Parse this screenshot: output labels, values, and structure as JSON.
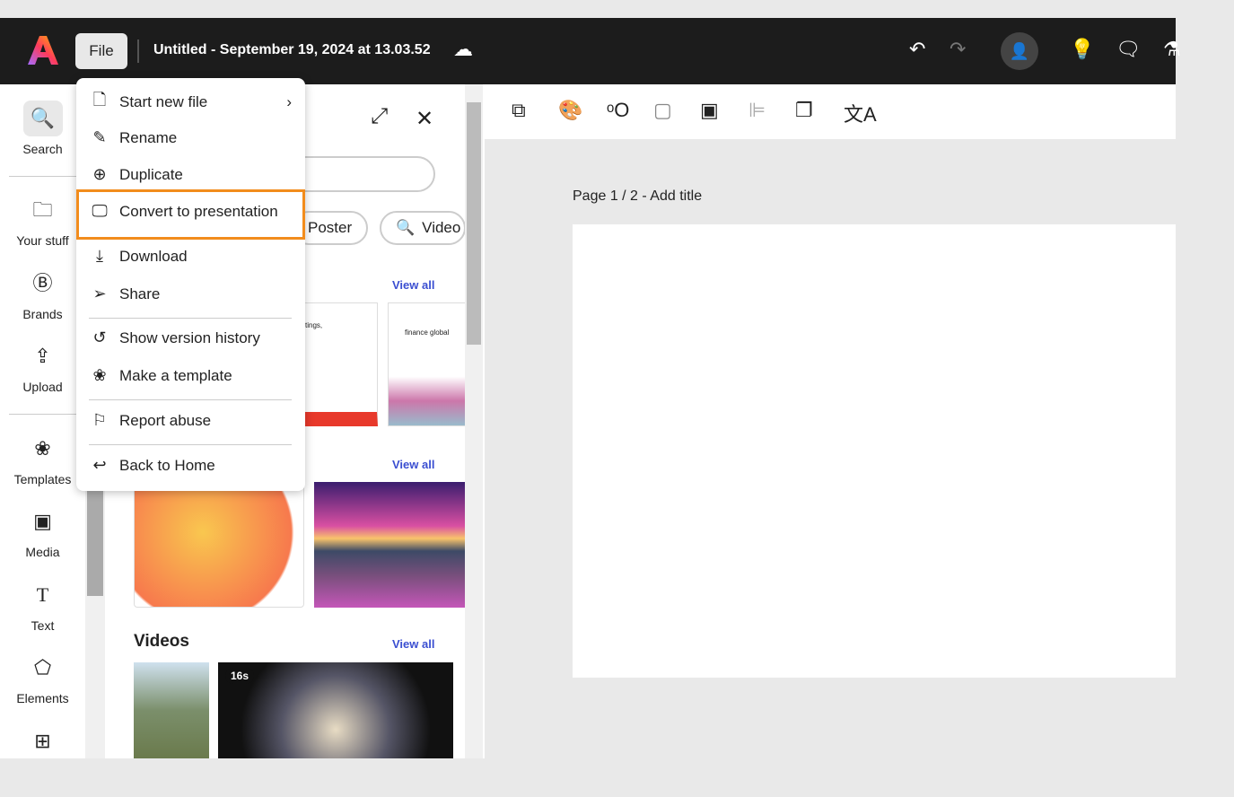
{
  "header": {
    "file_label": "File",
    "doc_title": "Untitled - September 19, 2024 at 13.03.52"
  },
  "sidebar": {
    "items": [
      {
        "label": "Search",
        "icon": "search-icon"
      },
      {
        "label": "Your stuff",
        "icon": "folder-icon"
      },
      {
        "label": "Brands",
        "icon": "brand-icon"
      },
      {
        "label": "Upload",
        "icon": "upload-icon"
      },
      {
        "label": "Templates",
        "icon": "templates-icon"
      },
      {
        "label": "Media",
        "icon": "media-icon"
      },
      {
        "label": "Text",
        "icon": "text-icon"
      },
      {
        "label": "Elements",
        "icon": "elements-icon"
      }
    ]
  },
  "menu": {
    "items": [
      "Start new file",
      "Rename",
      "Duplicate",
      "Convert to presentation",
      "Download",
      "Share",
      "Show version history",
      "Make a template",
      "Report abuse",
      "Back to Home"
    ]
  },
  "panel": {
    "chips": [
      "Poster",
      "Video"
    ],
    "view_all": "View all",
    "videos_heading": "Videos",
    "video_duration": "16s",
    "thumb1_text": "tings,",
    "thumb2_text": "finance global"
  },
  "canvas": {
    "page_label": "Page 1 / 2 - Add title"
  },
  "colors": {
    "highlight": "#f28c1c",
    "header": "#1c1c1c",
    "link": "#3b4fd1"
  }
}
